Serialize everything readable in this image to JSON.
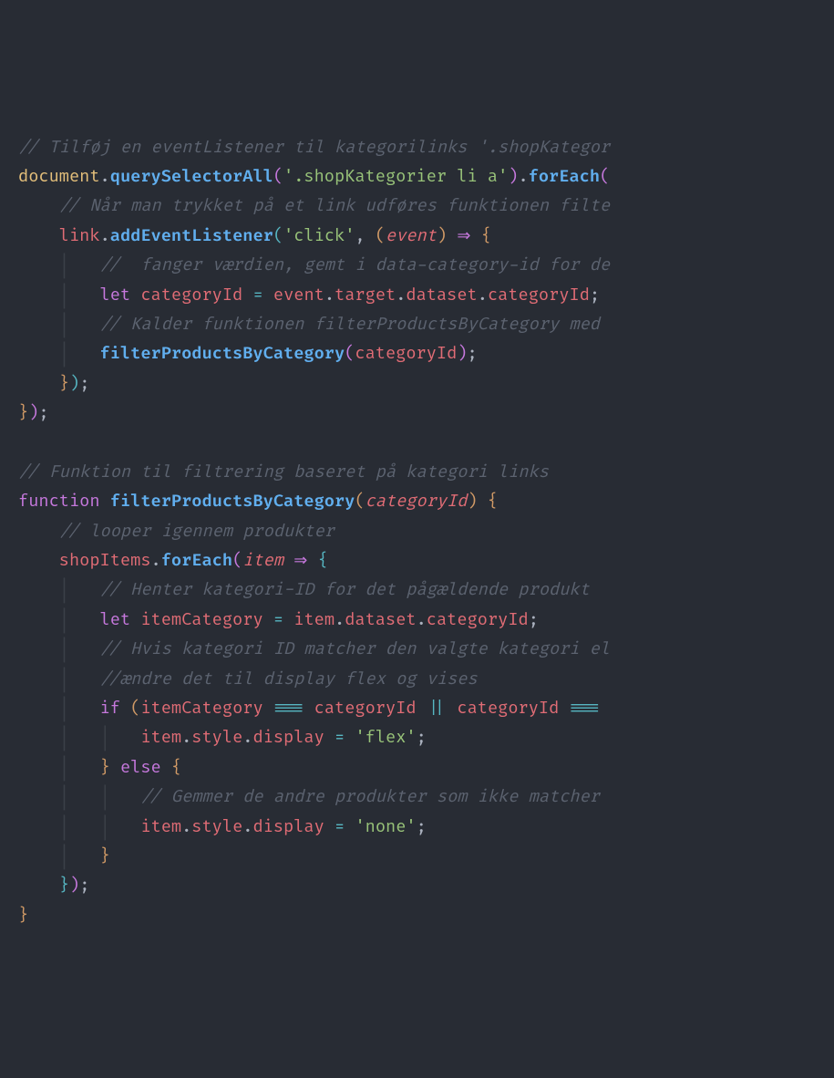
{
  "code": {
    "l1": "// Tilføj en eventListener til kategorilinks '.shopKategor",
    "l2a": "document",
    "l2b": "querySelectorAll",
    "l2c": "'.shopKategorier li a'",
    "l2d": "forEach",
    "l3": "// Når man trykket på et link udføres funktionen filte",
    "l4a": "link",
    "l4b": "addEventListener",
    "l4c": "'click'",
    "l4d": "event",
    "l5": "//  fanger værdien, gemt i data-category-id for de",
    "l6a": "let",
    "l6b": "categoryId",
    "l6c": "event",
    "l6d": "target",
    "l6e": "dataset",
    "l6f": "categoryId",
    "l7": "// Kalder funktionen filterProductsByCategory med ",
    "l8a": "filterProductsByCategory",
    "l8b": "categoryId",
    "l11": "// Funktion til filtrering baseret på kategori links",
    "l12a": "function",
    "l12b": "filterProductsByCategory",
    "l12c": "categoryId",
    "l13": "// looper igennem produkter",
    "l14a": "shopItems",
    "l14b": "forEach",
    "l14c": "item",
    "l15": "// Henter kategori-ID for det pågældende produkt",
    "l16a": "let",
    "l16b": "itemCategory",
    "l16c": "item",
    "l16d": "dataset",
    "l16e": "categoryId",
    "l17": "// Hvis kategori ID matcher den valgte kategori el",
    "l18": "//ændre det til display flex og vises",
    "l19a": "if",
    "l19b": "itemCategory",
    "l19c": "categoryId",
    "l19d": "categoryId",
    "l20a": "item",
    "l20b": "style",
    "l20c": "display",
    "l20d": "'flex'",
    "l21a": "else",
    "l22": "// Gemmer de andre produkter som ikke matcher",
    "l23a": "item",
    "l23b": "style",
    "l23c": "display",
    "l23d": "'none'"
  }
}
